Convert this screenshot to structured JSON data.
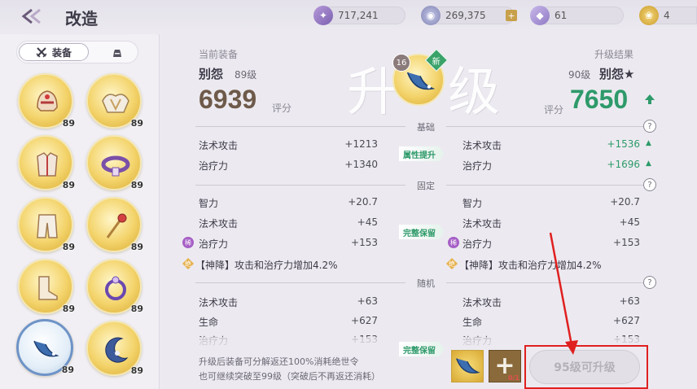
{
  "header": {
    "title": "改造",
    "resources": [
      {
        "icon": "crystal-icon",
        "value": "717,241"
      },
      {
        "icon": "coin-icon",
        "value": "269,375"
      },
      {
        "icon": "diamond-icon",
        "value": "61"
      },
      {
        "icon": "gold-icon",
        "value": "4"
      }
    ]
  },
  "left": {
    "tab_equip": "装备",
    "slots": [
      {
        "icon": "helmet-icon",
        "level": "89"
      },
      {
        "icon": "shoulder-armor-icon",
        "level": "89"
      },
      {
        "icon": "chest-armor-icon",
        "level": "89"
      },
      {
        "icon": "belt-icon",
        "level": "89"
      },
      {
        "icon": "pants-icon",
        "level": "89"
      },
      {
        "icon": "scepter-icon",
        "level": "89"
      },
      {
        "icon": "boots-icon",
        "level": "89"
      },
      {
        "icon": "ring-icon",
        "level": "89"
      },
      {
        "icon": "fish-pendant-icon",
        "level": "89"
      },
      {
        "icon": "crescent-pendant-icon",
        "level": "89"
      }
    ]
  },
  "main": {
    "big_char_left": "升",
    "big_char_right": "级",
    "current": {
      "label": "当前装备",
      "name": "别怨",
      "level": "89级",
      "score": "6939",
      "score_label": "评分"
    },
    "result": {
      "label": "升级结果",
      "level": "90级",
      "name": "别怨★",
      "score_label": "评分",
      "score": "7650"
    },
    "center_badge_num": "16",
    "center_badge_new": "新",
    "sections": {
      "base": "基础",
      "fixed": "固定",
      "random": "随机"
    },
    "q_mark": "?",
    "tags": {
      "attr_up": "属性提升",
      "keep1": "完整保留",
      "keep2": "完整保留"
    },
    "base_stats": [
      {
        "label": "法术攻击",
        "old": "+1213",
        "new": "+1536"
      },
      {
        "label": "治疗力",
        "old": "+1340",
        "new": "+1696"
      }
    ],
    "fixed_stats": [
      {
        "label": "智力",
        "old": "+20.7",
        "new": "+20.7"
      },
      {
        "label": "法术攻击",
        "old": "+45",
        "new": "+45"
      },
      {
        "label": "治疗力",
        "old": "+153",
        "new": "+153"
      }
    ],
    "mark_xi": "稀",
    "mark_jue": "绝",
    "special": "【神降】攻击和治疗力增加4.2%",
    "random_stats": [
      {
        "label": "法术攻击",
        "old": "+63",
        "new": "+63"
      },
      {
        "label": "生命",
        "old": "+627",
        "new": "+627"
      },
      {
        "label": "治疗力",
        "old": "+153",
        "new": "+153"
      }
    ],
    "notes": [
      "升级后装备可分解返还100%消耗绝世令",
      "也可继续突破至99级（突破后不再返还消耗）"
    ],
    "material_count": "0/1",
    "upgrade_button": "95级可升级"
  },
  "colors": {
    "score_new": "#2e9a6a",
    "score_old": "#6e5a4a",
    "annotation_red": "#e02020"
  }
}
